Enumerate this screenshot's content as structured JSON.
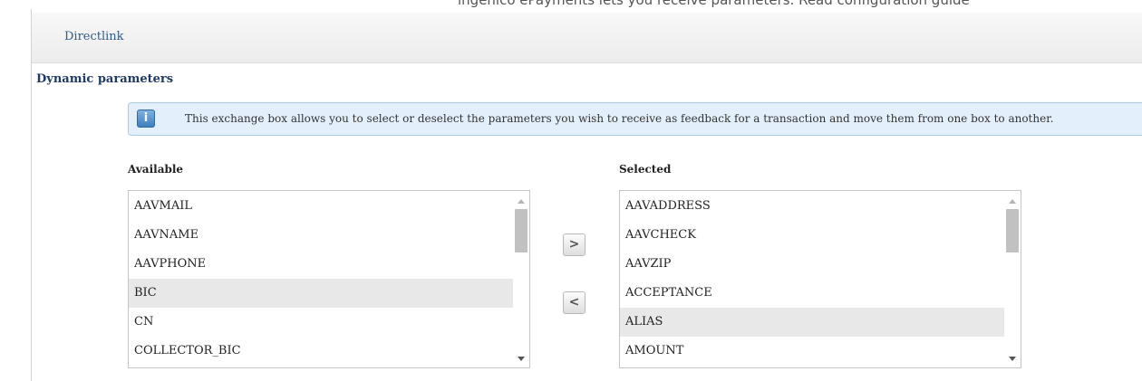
{
  "header": {
    "cut_text": "ingenico ePayments lets you receive parameters. Read configuration guide",
    "tab_label": "Directlink"
  },
  "section": {
    "title": "Dynamic parameters"
  },
  "info": {
    "icon": "info-icon",
    "glyph": "i",
    "text": "This exchange box allows you to select or deselect the parameters you wish to receive as feedback for a transaction and move them from one box to another."
  },
  "available": {
    "label": "Available",
    "items": [
      "AAVMAIL",
      "AAVNAME",
      "AAVPHONE",
      "BIC",
      "CN",
      "COLLECTOR_BIC"
    ],
    "selected_index": 3
  },
  "selected": {
    "label": "Selected",
    "items": [
      "AAVADDRESS",
      "AAVCHECK",
      "AAVZIP",
      "ACCEPTANCE",
      "ALIAS",
      "AMOUNT"
    ],
    "selected_index": 4
  },
  "buttons": {
    "add": ">",
    "remove": "<"
  }
}
